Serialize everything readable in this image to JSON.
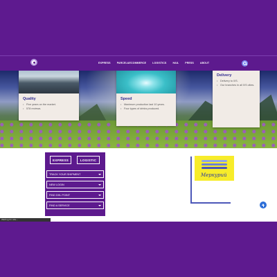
{
  "colors": {
    "frame": "#5e1a8f",
    "header": "#5d1a8e",
    "card_title": "#2f2a8f",
    "accent": "#7d8cf0"
  },
  "header": {
    "logo_icon": "circle-logo-icon",
    "nav": [
      "EXPRESS",
      "PARCEL&ECOMMERCE",
      "LOGISTICS",
      "HAIL",
      "PRESS",
      "ABOUT"
    ],
    "search_icon": "search-icon"
  },
  "cards": [
    {
      "title": "Quality",
      "items": [
        "Five years on the market.",
        "578 reviews."
      ]
    },
    {
      "title": "Speed",
      "items": [
        "Maximum production last 10 years.",
        "Four types of drinks produced."
      ]
    },
    {
      "title": "Delivery",
      "items": [
        "Delivery to 0/S.",
        "Our branches in all 0/S cities."
      ]
    }
  ],
  "widget": {
    "tabs": [
      "EXPRESS",
      "LOGISTIC"
    ],
    "dropdowns": [
      "TRACK YOUR SHIPMENT",
      "NEW LOGIN",
      "FIND DHL POINT",
      "FIND A SERVICE"
    ]
  },
  "partner": {
    "name": "Меркурий"
  },
  "status_bar": {
    "text": "Waiting for site..."
  }
}
